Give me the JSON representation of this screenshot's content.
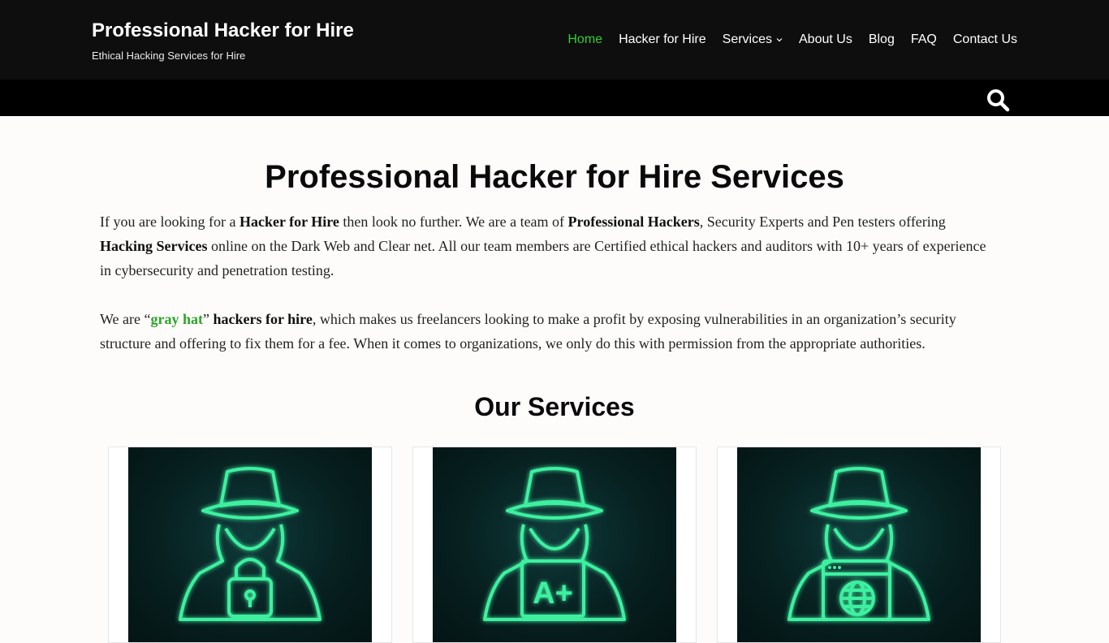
{
  "site": {
    "title": "Professional Hacker for Hire",
    "tagline": "Ethical Hacking Services for Hire"
  },
  "nav": {
    "items": [
      {
        "label": "Home",
        "active": true
      },
      {
        "label": "Hacker for Hire"
      },
      {
        "label": "Services",
        "has_dropdown": true
      },
      {
        "label": "About Us"
      },
      {
        "label": "Blog"
      },
      {
        "label": "FAQ"
      },
      {
        "label": "Contact Us"
      }
    ]
  },
  "search": {
    "icon": "search-icon"
  },
  "hero": {
    "title": "Professional Hacker for Hire Services"
  },
  "intro": {
    "p1_a": "If you are looking for a ",
    "p1_b": "Hacker for Hire",
    "p1_c": " then look no further. We are a team of  ",
    "p1_d": "Professional Hackers",
    "p1_e": ", Security Experts and Pen testers offering ",
    "p1_f": "Hacking Services",
    "p1_g": " online on the Dark Web and Clear net. All our team members are Certified ethical hackers and auditors with 10+ years of experience in cybersecurity and penetration testing.",
    "p2_a": "We are  “",
    "p2_link": "gray hat",
    "p2_b": "” ",
    "p2_c": "hackers for hire",
    "p2_d": ", which makes us freelancers looking to make a profit by exposing vulnerabilities in an organization’s security structure and offering to fix them for a fee. When it comes to organizations, we only do this with permission from the appropriate authorities."
  },
  "services": {
    "title": "Our Services",
    "cards": [
      {
        "icon": "hacker-lock-icon"
      },
      {
        "icon": "hacker-grade-icon",
        "badge": "A+"
      },
      {
        "icon": "hacker-web-icon"
      }
    ]
  },
  "colors": {
    "accent": "#32cd32",
    "header_bg": "#0e0e0e",
    "neon": "#3ef0a0"
  }
}
